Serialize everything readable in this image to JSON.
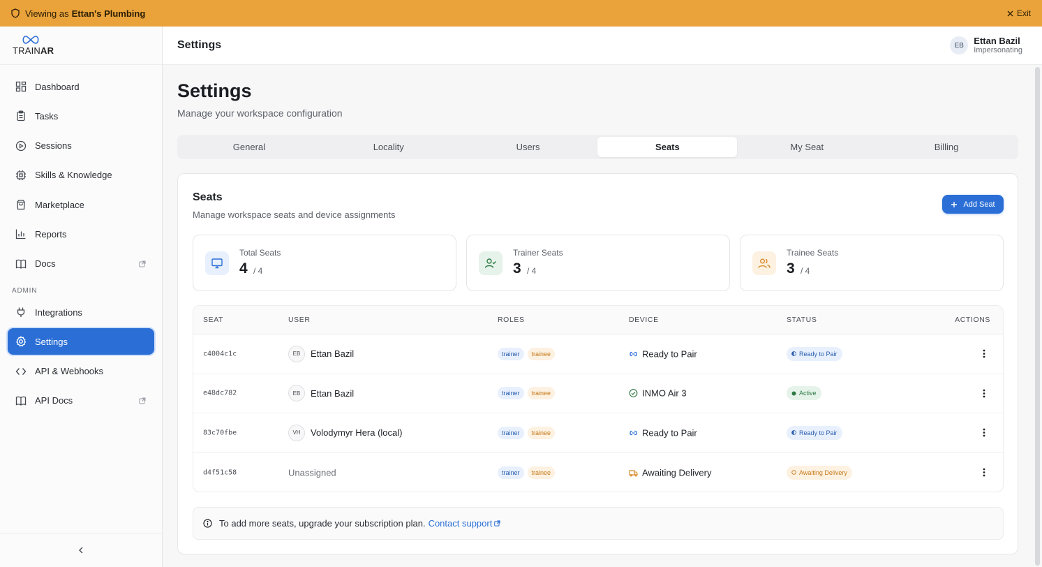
{
  "banner": {
    "viewing_prefix": "Viewing as",
    "workspace": "Ettan's Plumbing",
    "exit_label": "Exit"
  },
  "brand": {
    "word_light": "TRAIN",
    "word_bold": "AR"
  },
  "sidebar": {
    "items": [
      {
        "label": "Dashboard",
        "icon": "dashboard-icon"
      },
      {
        "label": "Tasks",
        "icon": "clipboard-icon"
      },
      {
        "label": "Sessions",
        "icon": "play-circle-icon"
      },
      {
        "label": "Skills & Knowledge",
        "icon": "chip-icon"
      },
      {
        "label": "Marketplace",
        "icon": "shopping-bag-icon"
      },
      {
        "label": "Reports",
        "icon": "bar-chart-icon"
      },
      {
        "label": "Docs",
        "icon": "book-icon",
        "external": true
      }
    ],
    "admin_label": "ADMIN",
    "admin_items": [
      {
        "label": "Integrations",
        "icon": "plug-icon"
      },
      {
        "label": "Settings",
        "icon": "gear-icon",
        "active": true
      },
      {
        "label": "API & Webhooks",
        "icon": "code-icon"
      },
      {
        "label": "API Docs",
        "icon": "book-icon",
        "external": true
      }
    ]
  },
  "header": {
    "title": "Settings",
    "user_initials": "EB",
    "user_name": "Ettan Bazil",
    "user_role": "Impersonating"
  },
  "page": {
    "title": "Settings",
    "subtitle": "Manage your workspace configuration"
  },
  "tabs": [
    {
      "label": "General"
    },
    {
      "label": "Locality"
    },
    {
      "label": "Users"
    },
    {
      "label": "Seats",
      "active": true
    },
    {
      "label": "My Seat"
    },
    {
      "label": "Billing"
    }
  ],
  "seats_card": {
    "title": "Seats",
    "subtitle": "Manage workspace seats and device assignments",
    "add_label": "Add Seat",
    "stats": [
      {
        "label": "Total Seats",
        "value": "4",
        "max": "/ 4",
        "icon": "monitor-icon",
        "tint": "#e8f0fd",
        "color": "#2b6fd6"
      },
      {
        "label": "Trainer Seats",
        "value": "3",
        "max": "/ 4",
        "icon": "user-check-icon",
        "tint": "#e6f3ea",
        "color": "#2f7a45"
      },
      {
        "label": "Trainee Seats",
        "value": "3",
        "max": "/ 4",
        "icon": "users-icon",
        "tint": "#fdf1e1",
        "color": "#d98b2b"
      }
    ],
    "columns": {
      "seat": "SEAT",
      "user": "USER",
      "roles": "ROLES",
      "device": "DEVICE",
      "status": "STATUS",
      "actions": "ACTIONS"
    },
    "rows": [
      {
        "seat": "c4004c1c",
        "initials": "EB",
        "user": "Ettan Bazil",
        "roles": [
          "trainer",
          "trainee"
        ],
        "device": "Ready to Pair",
        "device_icon": "link-icon",
        "status": "Ready to Pair",
        "status_kind": "pair"
      },
      {
        "seat": "e48dc782",
        "initials": "EB",
        "user": "Ettan Bazil",
        "roles": [
          "trainer",
          "trainee"
        ],
        "device": "INMO Air 3",
        "device_icon": "check-circle-icon",
        "status": "Active",
        "status_kind": "active"
      },
      {
        "seat": "83c70fbe",
        "initials": "VH",
        "user": "Volodymyr Hera (local)",
        "roles": [
          "trainer",
          "trainee"
        ],
        "device": "Ready to Pair",
        "device_icon": "link-icon",
        "status": "Ready to Pair",
        "status_kind": "pair"
      },
      {
        "seat": "d4f51c58",
        "initials": "",
        "user": "Unassigned",
        "roles": [
          "trainer",
          "trainee"
        ],
        "device": "Awaiting Delivery",
        "device_icon": "truck-icon",
        "status": "Awaiting Delivery",
        "status_kind": "await"
      }
    ],
    "note_text": "To add more seats, upgrade your subscription plan.",
    "note_link": "Contact support"
  },
  "colors": {
    "banner": "#e9a33a",
    "accent": "#2b6fd6"
  }
}
